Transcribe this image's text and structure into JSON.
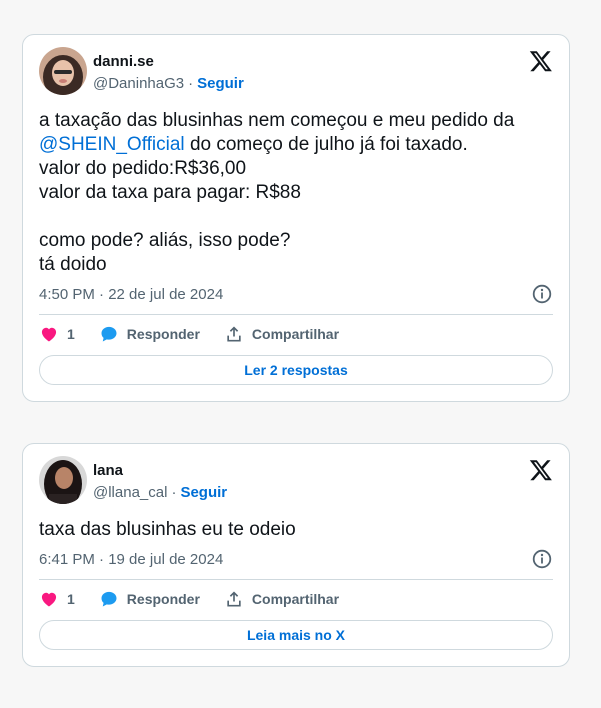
{
  "tweets": [
    {
      "author": {
        "name": "danni.se",
        "handle": "@DaninhaG3",
        "follow_label": "Seguir"
      },
      "body": {
        "lines": [
          "a taxação das blusinhas nem começou e meu pedido da",
          "do começo de julho já foi taxado.",
          "valor do pedido:R$36,00",
          "valor da taxa para pagar: R$88",
          "",
          "como pode? aliás, isso pode?",
          "tá doido"
        ],
        "mention": "@SHEIN_Official"
      },
      "timestamp": "4:50 PM · 22 de jul de 2024",
      "actions": {
        "like_count": "1",
        "reply_label": "Responder",
        "share_label": "Compartilhar"
      },
      "footer_button": "Ler 2 respostas"
    },
    {
      "author": {
        "name": "lana",
        "handle": "@llana_cal",
        "follow_label": "Seguir"
      },
      "body": {
        "lines": [
          "taxa das blusinhas eu te odeio"
        ]
      },
      "timestamp": "6:41 PM · 19 de jul de 2024",
      "actions": {
        "like_count": "1",
        "reply_label": "Responder",
        "share_label": "Compartilhar"
      },
      "footer_button": "Leia mais no X"
    }
  ],
  "colors": {
    "link": "#006fd6",
    "like": "#f91880",
    "reply": "#1d9bf0",
    "secondary_text": "#536471",
    "border": "#cfd9de"
  },
  "icons": [
    "x-logo-icon",
    "info-icon",
    "heart-icon",
    "reply-bubble-icon",
    "share-icon"
  ]
}
